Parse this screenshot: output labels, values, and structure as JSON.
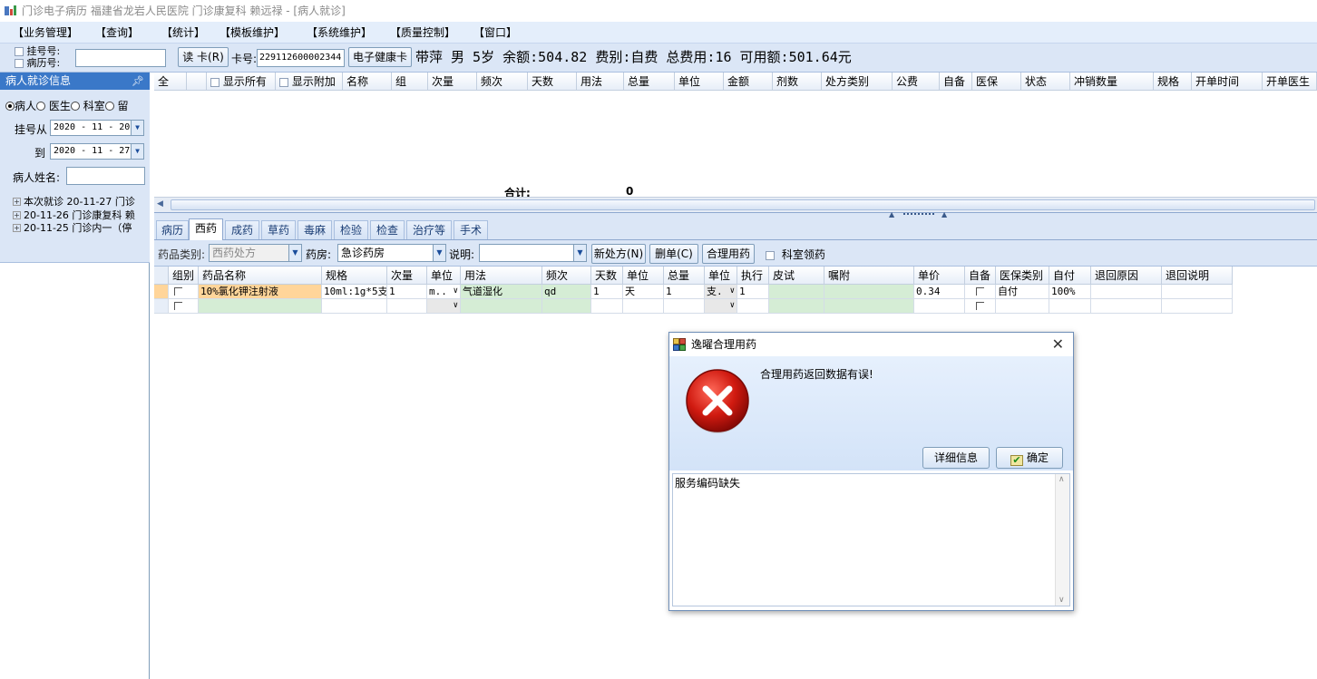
{
  "window": {
    "title": "门诊电子病历  福建省龙岩人民医院  门诊康复科  赖远禄 - [病人就诊]"
  },
  "menu": [
    "【业务管理】",
    "【查询】",
    "【统计】",
    "【模板维护】",
    "【系统维护】",
    "【质量控制】",
    "【窗口】"
  ],
  "toolbar": {
    "reg_no_label": "挂号号:",
    "record_no_label": "病历号:",
    "read_card_label": "读 卡(R)",
    "card_no_label": "卡号:",
    "card_no_value": "229112600002344",
    "ehealth_card_label": "电子健康卡",
    "patient_summary": "带萍 男 5岁 余额:504.82 费别:自费 总费用:16 可用额:501.64元"
  },
  "left_panel": {
    "header": "病人就诊信息",
    "pin": "→",
    "radios": [
      "病人",
      "医生",
      "科室",
      "留"
    ],
    "reg_from_label": "挂号从",
    "reg_from_value": "2020 - 11 - 20",
    "reg_to_label": "到",
    "reg_to_value": "2020 - 11 - 27",
    "patient_name_label": "病人姓名:",
    "visits": [
      "本次就诊 20-11-27 门诊",
      "20-11-26 门诊康复科 赖",
      "20-11-25 门诊内一（停"
    ]
  },
  "top_grid": {
    "headers": [
      "全",
      "",
      "显示所有",
      "显示附加",
      "名称",
      "组",
      "次量",
      "频次",
      "天数",
      "用法",
      "总量",
      "单位",
      "金额",
      "剂数",
      "处方类别",
      "公费",
      "自备",
      "医保",
      "状态",
      "冲销数量",
      "规格",
      "开单时间",
      "开单医生"
    ],
    "total_label": "合计:",
    "total_value": "0"
  },
  "tabs": [
    "病历",
    "西药",
    "成药",
    "草药",
    "毒麻",
    "检验",
    "检查",
    "治疗等",
    "手术"
  ],
  "rx_bar": {
    "drug_category_label": "药品类别:",
    "drug_category_value": "西药处方",
    "pharmacy_label": "药房:",
    "pharmacy_value": "急诊药房",
    "note_label": "说明:",
    "note_value": "",
    "new_rx_button": "新处方(N)",
    "delete_rx_button": "删单(C)",
    "rational_drug_button": "合理用药",
    "dept_pickup_label": "科室领药"
  },
  "rx_grid": {
    "headers": [
      "组别",
      "药品名称",
      "规格",
      "次量",
      "单位",
      "用法",
      "频次",
      "天数",
      "单位",
      "总量",
      "单位",
      "执行",
      "皮试",
      "嘱附",
      "单价",
      "自备",
      "医保类别",
      "自付",
      "退回原因",
      "退回说明"
    ],
    "rows": [
      {
        "drug_name": "10%氯化钾注射液",
        "spec": "10ml:1g*5支",
        "dose": "1",
        "dose_unit": "m..",
        "usage": "气道湿化",
        "freq": "qd",
        "days": "1",
        "days_unit": "天",
        "total": "1",
        "total_unit": "支.",
        "exec": "1",
        "price": "0.34",
        "insurance_type": "自付",
        "self_pay": "100%"
      }
    ]
  },
  "dialog": {
    "title": "逸曜合理用药",
    "message": "合理用药返回数据有误!",
    "details_button": "详细信息",
    "ok_button": "确定",
    "detail_text": "服务编码缺失"
  }
}
